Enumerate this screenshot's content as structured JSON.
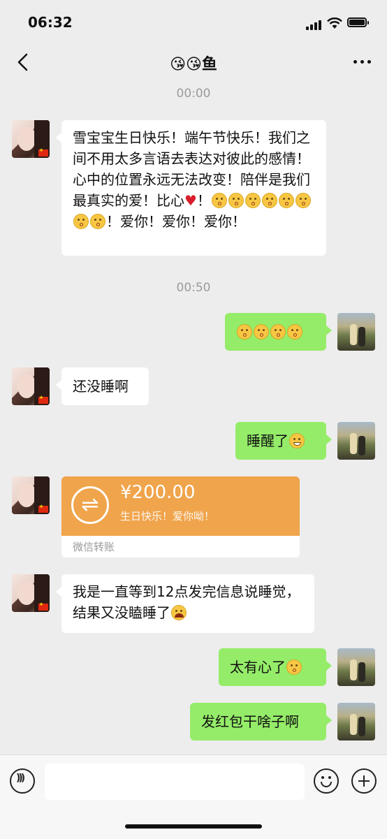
{
  "status_bar": {
    "time": "06:32"
  },
  "header": {
    "title": "😘😘鱼"
  },
  "timestamps": [
    "00:00",
    "00:50"
  ],
  "messages": [
    {
      "side": "left",
      "text": "雪宝宝生日快乐！端午节快乐！我们之间不用太多言语去表达对彼此的感情！心中的位置永远无法改变！陪伴是我们最真实的爱！比心",
      "tail_1": "！",
      "tail_2": "！爱你！爱你！爱你！",
      "heart": "♥"
    },
    {
      "side": "right",
      "text": ""
    },
    {
      "side": "left",
      "text": "还没睡啊"
    },
    {
      "side": "right",
      "text": "睡醒了"
    },
    {
      "side": "left",
      "text": "我是一直等到12点发完信息说睡觉，结果又没瞌睡了"
    },
    {
      "side": "right",
      "text": "太有心了"
    },
    {
      "side": "right",
      "text": "发红包干啥子啊"
    }
  ],
  "transfer": {
    "amount": "¥200.00",
    "note": "生日快乐！爱你呦！",
    "label": "微信转账"
  },
  "colors": {
    "accent_green": "#95ec69",
    "transfer_orange": "#f0a44b",
    "background": "#ededed"
  }
}
